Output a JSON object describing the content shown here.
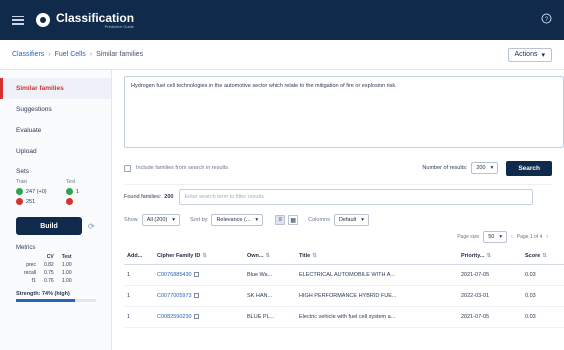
{
  "header": {
    "title": "Classification",
    "subtitle": "Predictive Guide",
    "right_icon": "help-circle-icon"
  },
  "breadcrumb": {
    "items": [
      "Classifiers",
      "Fuel Cells",
      "Similar families"
    ],
    "actions_label": "Actions"
  },
  "sidebar": {
    "items": [
      "Similar families",
      "Suggestions",
      "Evaluate",
      "Upload"
    ],
    "sets_label": "Sets",
    "sets_col_train": "Train",
    "sets_col_test": "Test",
    "sets_row1_train": "247 (+0)",
    "sets_row1_test": "1",
    "sets_row2_train": "251",
    "sets_row2_test": "",
    "build_label": "Build",
    "metrics_label": "Metrics",
    "metrics": {
      "headers": [
        "",
        "CV",
        "Test"
      ],
      "rows": [
        [
          "prec",
          "0.82",
          "1.00"
        ],
        [
          "recall",
          "0.75",
          "1.00"
        ],
        [
          "f1",
          "0.76",
          "1.00"
        ]
      ]
    },
    "strength_label": "Strength: 74% (high)",
    "strength_value": 0.74
  },
  "main": {
    "query_text": "Hydrogen fuel cell technologies in the automotive sector which relate to the mitigation of fire or explosion risk.",
    "include_label": "Include families from search in results",
    "num_results_label": "Number of results:",
    "num_results_value": "200",
    "search_label": "Search",
    "found_label": "Found families:",
    "found_count": "200",
    "filter_placeholder": "Enter search term to filter results",
    "show_label": "Show",
    "show_value": "All (200)",
    "sort_label": "Sort by",
    "sort_value": "Relevance (...",
    "columns_label": "Columns",
    "columns_value": "Default",
    "page_size_label": "Page size",
    "page_size_value": "50",
    "page_info": "Page 1 of 4"
  },
  "table": {
    "headers": [
      "Add...",
      "Cipher Family ID",
      "Own...",
      "Title",
      "Priority...",
      "Score"
    ],
    "rows": [
      [
        "1",
        "C0076885430",
        "Blue Wa...",
        "ELECTRICAL AUTOMOBILE WITH A...",
        "2021-07-05",
        "0.03"
      ],
      [
        "1",
        "C0077005973",
        "SK HAN...",
        "HIGH PERFORMANCE HYBRID FUE...",
        "2022-03-01",
        "0.03"
      ],
      [
        "1",
        "C0082590230",
        "BLUE PL...",
        "Electric vehicle with fuel cell system a...",
        "2021-07-05",
        "0.03"
      ]
    ]
  },
  "colors": {
    "navy": "#0f2a4a",
    "accent_red": "#d63232",
    "link_blue": "#2a63b7",
    "green": "#2fa34a"
  }
}
